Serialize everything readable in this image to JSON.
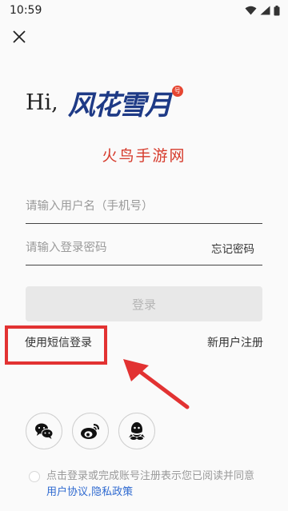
{
  "status_bar": {
    "time": "10:59"
  },
  "greeting": "Hi,",
  "logo": {
    "text": "风花雪月",
    "badge": "号"
  },
  "subtitle": "火鸟手游网",
  "username": {
    "placeholder": "请输入用户名（手机号）",
    "value": ""
  },
  "password": {
    "placeholder": "请输入登录密码",
    "value": ""
  },
  "forgot_password": "忘记密码",
  "login_button": "登录",
  "sms_login": "使用短信登录",
  "register": "新用户注册",
  "social": [
    "wechat-icon",
    "weibo-icon",
    "qq-icon"
  ],
  "agreement": {
    "prefix": "点击登录或完成账号注册表示您已阅读并同意",
    "user_agreement": "用户协议",
    "separator": ",",
    "privacy_policy": "隐私政策"
  },
  "colors": {
    "accent_red": "#d63a2b",
    "logo_blue": "#1e3a86",
    "link_blue": "#2f6ad0",
    "highlight_red": "#e23232"
  }
}
